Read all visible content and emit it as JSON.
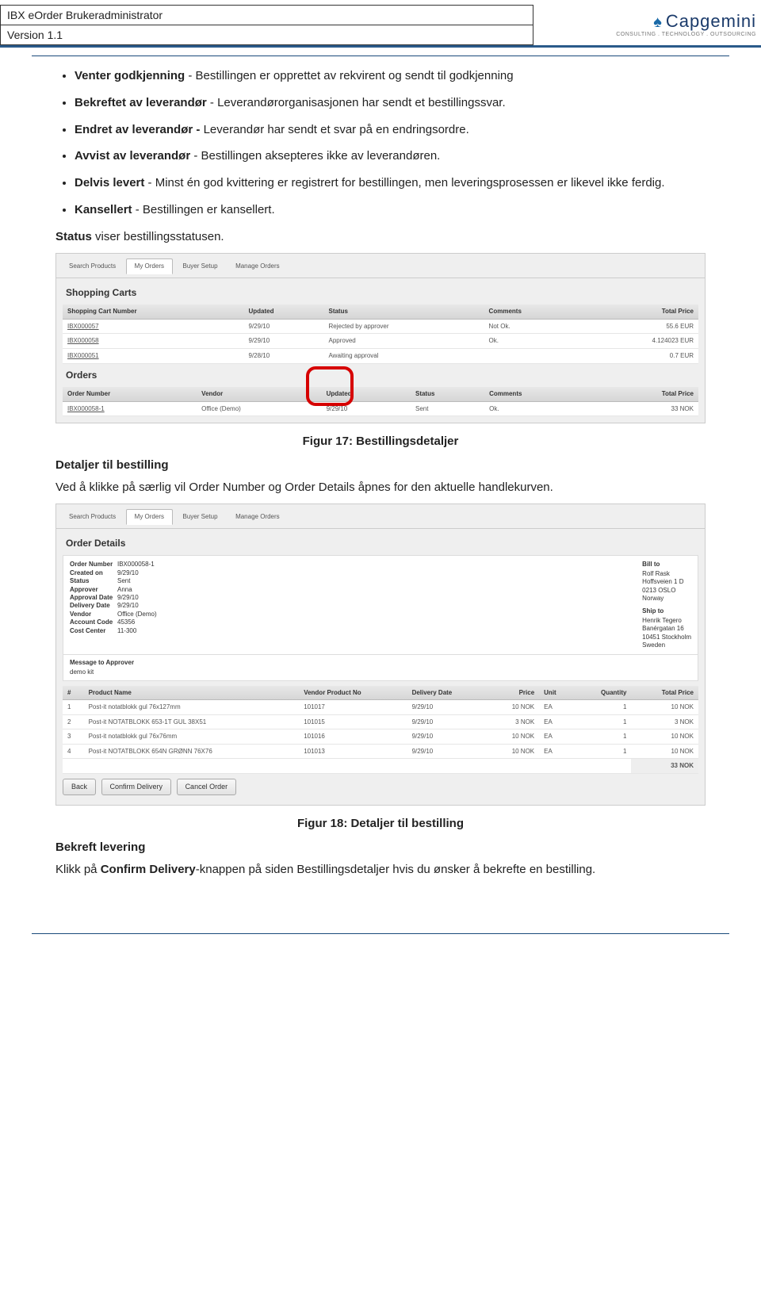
{
  "header": {
    "doc_title": "IBX eOrder Brukeradministrator",
    "version": "Version 1.1",
    "logo_main": "Capgemini",
    "logo_sub": "CONSULTING . TECHNOLOGY . OUTSOURCING"
  },
  "bullets": {
    "b1a": "Venter godkjenning",
    "b1b": " - Bestillingen er opprettet av rekvirent og sendt til godkjenning",
    "b2a": "Bekreftet av leverandør",
    "b2b": " - Leverandørorganisasjonen har sendt et bestillingssvar.",
    "b3a": "Endret av leverandør - ",
    "b3b": "Leverandør har sendt et svar på en endringsordre.",
    "b4a": "Avvist av leverandør",
    "b4b": " - Bestillingen aksepteres ikke av leverandøren.",
    "b5a": "Delvis levert",
    "b5b": " - Minst én god kvittering er registrert for bestillingen, men leveringsprosessen er likevel ikke ferdig.",
    "b6a": "Kansellert",
    "b6b": " - Bestillingen er kansellert."
  },
  "para": {
    "status1a": "Status",
    "status1b": " viser bestillingsstatusen.",
    "detaljer_h": "Detaljer til bestilling",
    "detaljer_p": "Ved å klikke på særlig vil Order Number og Order Details åpnes for den aktuelle handlekurven.",
    "bekreft_h": "Bekreft levering",
    "bekreft_p1": "Klikk på ",
    "bekreft_p2": "Confirm Delivery",
    "bekreft_p3": "-knappen på siden Bestillingsdetaljer hvis du ønsker å bekrefte en bestilling."
  },
  "fig": {
    "f17": "Figur 17: Bestillingsdetaljer",
    "f18": "Figur 18: Detaljer til bestilling"
  },
  "shot1": {
    "tabs": [
      "Search Products",
      "My Orders",
      "Buyer Setup",
      "Manage Orders"
    ],
    "sect1": "Shopping Carts",
    "cols1": [
      "Shopping Cart Number",
      "Updated",
      "Status",
      "Comments",
      "Total Price"
    ],
    "rows1": [
      {
        "num": "IBX000057",
        "updated": "9/29/10",
        "status": "Rejected by approver",
        "comments": "Not Ok.",
        "price": "55.6 EUR"
      },
      {
        "num": "IBX000058",
        "updated": "9/29/10",
        "status": "Approved",
        "comments": "Ok.",
        "price": "4.124023 EUR"
      },
      {
        "num": "IBX000051",
        "updated": "9/28/10",
        "status": "Awaiting approval",
        "comments": "",
        "price": "0.7 EUR"
      }
    ],
    "sect2": "Orders",
    "cols2": [
      "Order Number",
      "Vendor",
      "Updated",
      "Status",
      "Comments",
      "Total Price"
    ],
    "rows2": [
      {
        "num": "IBX000058-1",
        "vendor": "Office (Demo)",
        "updated": "9/29/10",
        "status": "Sent",
        "comments": "Ok.",
        "price": "33 NOK"
      }
    ]
  },
  "shot2": {
    "tabs": [
      "Search Products",
      "My Orders",
      "Buyer Setup",
      "Manage Orders"
    ],
    "title": "Order Details",
    "left": {
      "Order Number": "IBX000058-1",
      "Created on": "9/29/10",
      "Status": "Sent",
      "Approver": "Anna",
      "Approval Date": "9/29/10",
      "Delivery Date": "9/29/10",
      "Vendor": "Office (Demo)",
      "Account Code": "45356",
      "Cost Center": "11-300"
    },
    "bill": {
      "h": "Bill to",
      "lines": [
        "Rolf Rask",
        "Hoffsveien 1 D",
        "0213 OSLO",
        "Norway"
      ]
    },
    "ship": {
      "h": "Ship to",
      "lines": [
        "Henrik Tegero",
        "Banérgatan 16",
        "10451 Stockholm",
        "Sweden"
      ]
    },
    "msg_h": "Message to Approver",
    "msg_v": "demo kit",
    "cols": [
      "#",
      "Product Name",
      "Vendor Product No",
      "Delivery Date",
      "Price",
      "Unit",
      "Quantity",
      "Total Price"
    ],
    "rows": [
      {
        "n": "1",
        "name": "Post-it notatblokk gul 76x127mm",
        "vpn": "101017",
        "dd": "9/29/10",
        "price": "10 NOK",
        "unit": "EA",
        "qty": "1",
        "tot": "10 NOK"
      },
      {
        "n": "2",
        "name": "Post-it NOTATBLOKK 653-1T GUL 38X51",
        "vpn": "101015",
        "dd": "9/29/10",
        "price": "3 NOK",
        "unit": "EA",
        "qty": "1",
        "tot": "3 NOK"
      },
      {
        "n": "3",
        "name": "Post-it notatblokk gul 76x76mm",
        "vpn": "101016",
        "dd": "9/29/10",
        "price": "10 NOK",
        "unit": "EA",
        "qty": "1",
        "tot": "10 NOK"
      },
      {
        "n": "4",
        "name": "Post-it NOTATBLOKK 654N GRØNN 76X76",
        "vpn": "101013",
        "dd": "9/29/10",
        "price": "10 NOK",
        "unit": "EA",
        "qty": "1",
        "tot": "10 NOK"
      }
    ],
    "total": "33 NOK",
    "buttons": [
      "Back",
      "Confirm Delivery",
      "Cancel Order"
    ]
  }
}
